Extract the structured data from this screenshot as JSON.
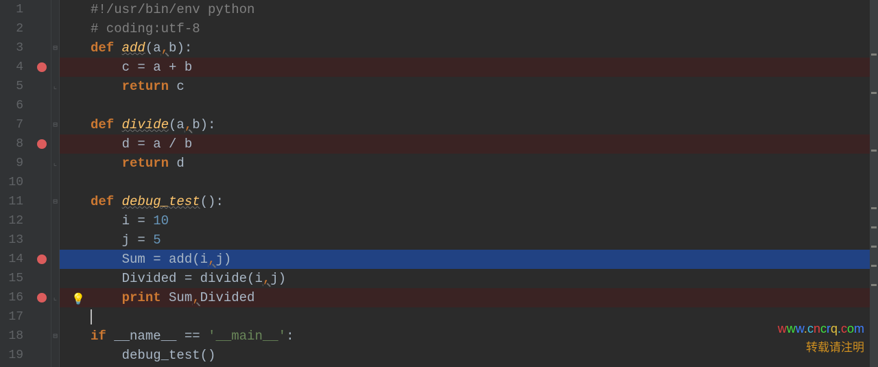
{
  "lines": [
    {
      "n": 1,
      "bp": false,
      "fold": "",
      "hl": "",
      "tokens": [
        [
          "cmt",
          "#!/usr/bin/env python"
        ]
      ]
    },
    {
      "n": 2,
      "bp": false,
      "fold": "",
      "hl": "",
      "tokens": [
        [
          "cmt",
          "# coding:utf-8"
        ]
      ]
    },
    {
      "n": 3,
      "bp": false,
      "fold": "top",
      "hl": "",
      "tokens": [
        [
          "kw",
          "def "
        ],
        [
          "fn",
          "add"
        ],
        [
          "op",
          "(a"
        ],
        [
          "comma-warn",
          ","
        ],
        [
          "op",
          "b):"
        ]
      ]
    },
    {
      "n": 4,
      "bp": true,
      "fold": "",
      "hl": "bp",
      "tokens": [
        [
          "op",
          "    c = a + b"
        ]
      ]
    },
    {
      "n": 5,
      "bp": false,
      "fold": "bot",
      "hl": "",
      "tokens": [
        [
          "op",
          "    "
        ],
        [
          "kw",
          "return"
        ],
        [
          "op",
          " c"
        ]
      ]
    },
    {
      "n": 6,
      "bp": false,
      "fold": "",
      "hl": "",
      "tokens": []
    },
    {
      "n": 7,
      "bp": false,
      "fold": "top",
      "hl": "",
      "tokens": [
        [
          "kw",
          "def "
        ],
        [
          "fn",
          "divide"
        ],
        [
          "op",
          "(a"
        ],
        [
          "comma-warn",
          ","
        ],
        [
          "op",
          "b):"
        ]
      ]
    },
    {
      "n": 8,
      "bp": true,
      "fold": "",
      "hl": "bp",
      "tokens": [
        [
          "op",
          "    d = a / b"
        ]
      ]
    },
    {
      "n": 9,
      "bp": false,
      "fold": "bot",
      "hl": "",
      "tokens": [
        [
          "op",
          "    "
        ],
        [
          "kw",
          "return"
        ],
        [
          "op",
          " d"
        ]
      ]
    },
    {
      "n": 10,
      "bp": false,
      "fold": "",
      "hl": "",
      "tokens": []
    },
    {
      "n": 11,
      "bp": false,
      "fold": "top",
      "hl": "",
      "tokens": [
        [
          "kw",
          "def "
        ],
        [
          "fn",
          "debug_test"
        ],
        [
          "op",
          "():"
        ]
      ]
    },
    {
      "n": 12,
      "bp": false,
      "fold": "",
      "hl": "",
      "tokens": [
        [
          "op",
          "    i = "
        ],
        [
          "num",
          "10"
        ]
      ]
    },
    {
      "n": 13,
      "bp": false,
      "fold": "",
      "hl": "",
      "tokens": [
        [
          "op",
          "    j = "
        ],
        [
          "num",
          "5"
        ]
      ]
    },
    {
      "n": 14,
      "bp": true,
      "fold": "",
      "hl": "exec",
      "tokens": [
        [
          "op",
          "    Sum = add(i"
        ],
        [
          "comma-warn",
          ","
        ],
        [
          "op",
          "j)"
        ]
      ]
    },
    {
      "n": 15,
      "bp": false,
      "fold": "",
      "hl": "",
      "tokens": [
        [
          "op",
          "    Divided = divide(i"
        ],
        [
          "comma-warn",
          ","
        ],
        [
          "op",
          "j)"
        ]
      ]
    },
    {
      "n": 16,
      "bp": true,
      "fold": "bot",
      "hl": "bp",
      "tokens": [
        [
          "op",
          "    "
        ],
        [
          "kw",
          "print"
        ],
        [
          "op",
          " Sum"
        ],
        [
          "comma-warn",
          ","
        ],
        [
          "op",
          "Divided"
        ]
      ]
    },
    {
      "n": 17,
      "bp": false,
      "fold": "",
      "hl": "",
      "tokens": [
        [
          "caret",
          ""
        ]
      ]
    },
    {
      "n": 18,
      "bp": false,
      "fold": "top",
      "hl": "",
      "tokens": [
        [
          "kw",
          "if"
        ],
        [
          "op",
          " __name__ == "
        ],
        [
          "str",
          "'__main__'"
        ],
        [
          "op",
          ":"
        ]
      ]
    },
    {
      "n": 19,
      "bp": false,
      "fold": "",
      "hl": "",
      "tokens": [
        [
          "op",
          "    debug_test()"
        ]
      ]
    }
  ],
  "bulb": "💡",
  "watermark": {
    "url": "www.cncrq.com",
    "sub": "转载请注明"
  },
  "fold_glyphs": {
    "top": "⊟",
    "bot": "⌞"
  },
  "minimap_positions": [
    78,
    134,
    218,
    302,
    330,
    358,
    386,
    414
  ]
}
